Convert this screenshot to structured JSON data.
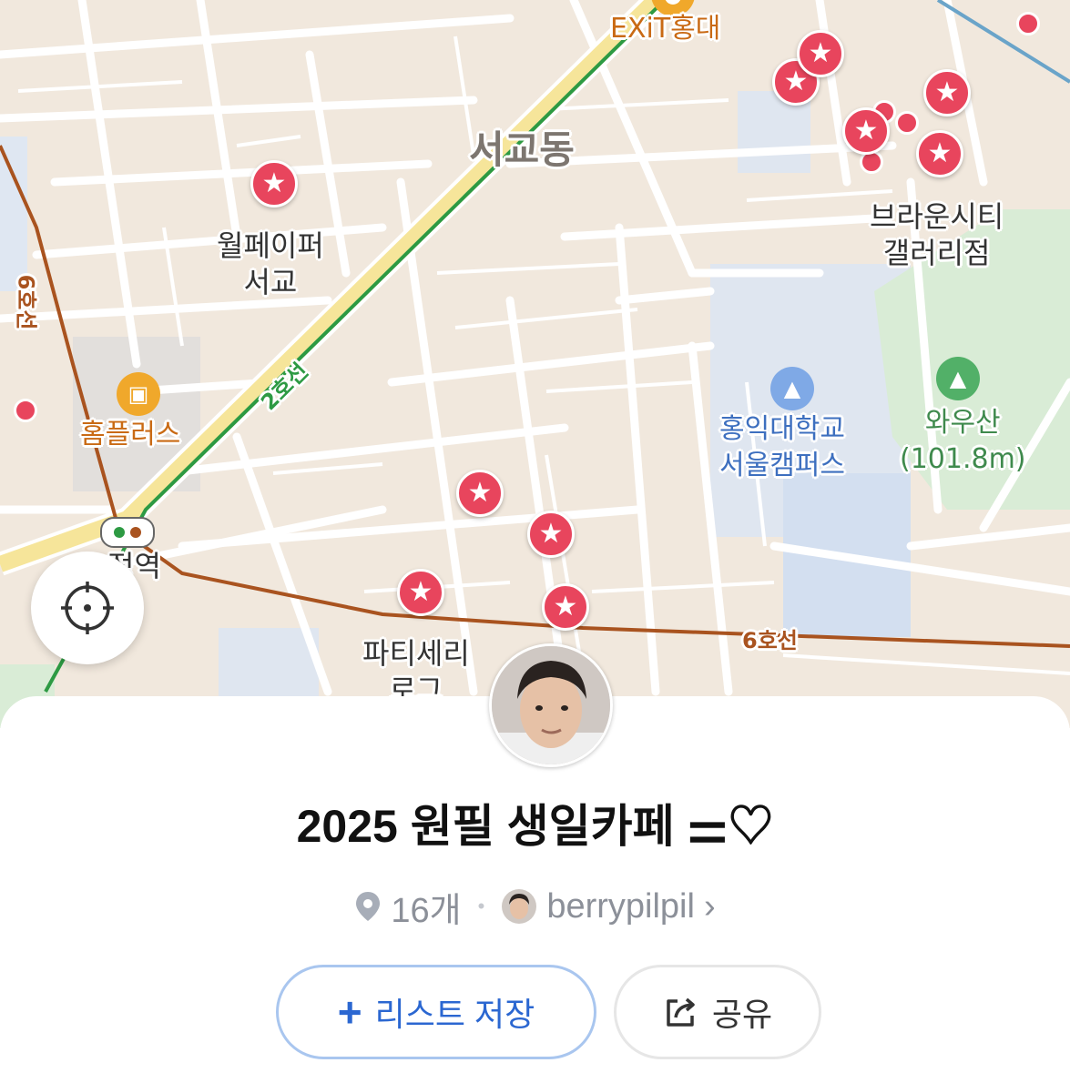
{
  "map": {
    "district_label": "서교동",
    "poi_labels": {
      "exit_hongdae": "EXiT홍대",
      "wallpaper_line1": "월페이퍼",
      "wallpaper_line2": "서교",
      "brown_city_line1": "브라운시티",
      "brown_city_line2": "갤러리점",
      "homeplus": "홈플러스",
      "hongik_line1": "홍익대학교",
      "hongik_line2": "서울캠퍼스",
      "wausan_line1": "와우산",
      "wausan_line2": "(101.8m)",
      "station": "정역",
      "patisserie_line1": "파티세리",
      "patisserie_line2": "로그"
    },
    "subway_labels": {
      "line6_vertical": "6호선",
      "line2": "2호선",
      "line6_horizontal": "6호선"
    },
    "colors": {
      "pin": "#e8455d",
      "line6": "#a9531f",
      "line2": "#2d9a43"
    }
  },
  "list": {
    "title": "2025 원필 생일카페 ⚌♡",
    "place_count": "16개",
    "separator": "•",
    "author": "berrypilpil",
    "author_chevron": "›"
  },
  "actions": {
    "save_icon": "+",
    "save_label": "리스트 저장",
    "share_label": "공유"
  }
}
